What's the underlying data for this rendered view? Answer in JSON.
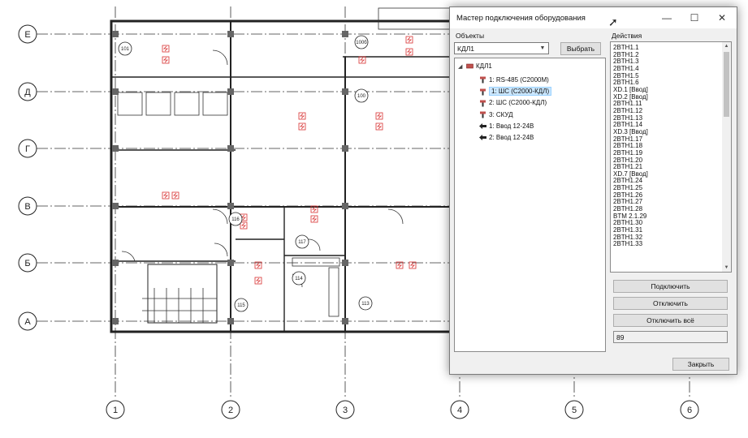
{
  "plan": {
    "row_axes": [
      "Е",
      "Д",
      "Г",
      "В",
      "Б",
      "А"
    ],
    "col_axes": [
      "1",
      "2",
      "3",
      "4",
      "5",
      "6"
    ],
    "rooms": [
      "101",
      "100",
      "100б",
      "116",
      "117",
      "114",
      "115",
      "113"
    ]
  },
  "dialog": {
    "title": "Мастер подключения оборудования",
    "objects_label": "Объекты",
    "actions_label": "Действия",
    "selected_object": "КДЛ1",
    "select_button": "Выбрать",
    "tree": {
      "root": "КДЛ1",
      "children": [
        {
          "label": "1: RS-485 (С2000М)",
          "icon": "device-icon"
        },
        {
          "label": "1: ШС  (С2000-КДЛ)",
          "icon": "device-icon",
          "selected": true
        },
        {
          "label": "2: ШС  (С2000-КДЛ)",
          "icon": "device-icon"
        },
        {
          "label": "3: СКУД",
          "icon": "device-icon"
        },
        {
          "label": "1: Ввод 12-24В",
          "icon": "arrow-left-icon"
        },
        {
          "label": "2: Ввод 12-24В",
          "icon": "arrow-left-icon"
        }
      ]
    },
    "actions": [
      "2BTH1.1",
      "2BTH1.2",
      "2BTH1.3",
      "2BTH1.4",
      "2BTH1.5",
      "2BTH1.6",
      "XD.1 [Ввод]",
      "XD.2 [Ввод]",
      "2BTH1.11",
      "2BTH1.12",
      "2BTH1.13",
      "2BTH1.14",
      "XD.3 [Ввод]",
      "2BTH1.17",
      "2BTH1.18",
      "2BTH1.19",
      "2BTH1.20",
      "2BTH1.21",
      "XD.7 [Ввод]",
      "2BTH1.24",
      "2BTH1.25",
      "2BTH1.26",
      "2BTH1.27",
      "2BTH1.28",
      "BTM 2.1.29",
      "2BTH1.30",
      "2BTH1.31",
      "2BTH1.32",
      "2BTH1.33"
    ],
    "connect_button": "Подключить",
    "disconnect_button": "Отключить",
    "disconnect_all_button": "Отключить всё",
    "count": "89",
    "close_button": "Закрыть",
    "window_controls": {
      "minimize": "—",
      "maximize": "☐",
      "close": "✕"
    }
  }
}
